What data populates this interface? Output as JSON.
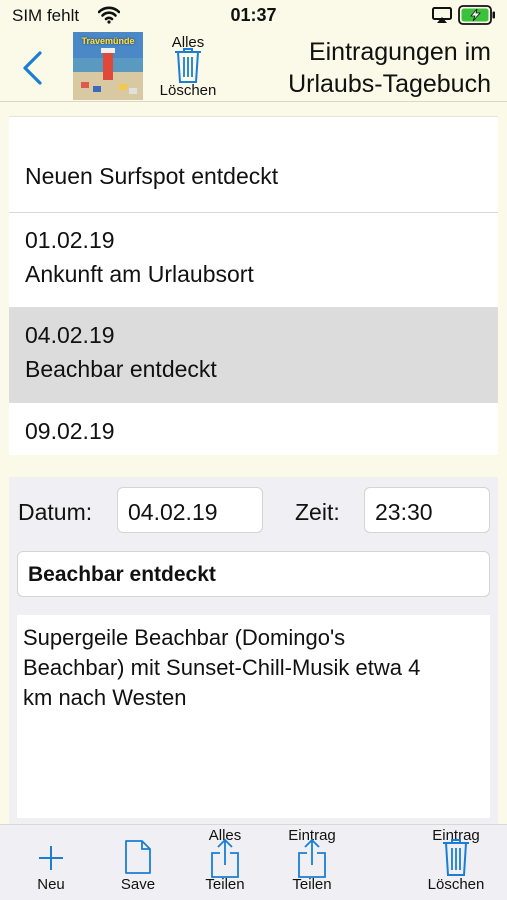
{
  "status_bar": {
    "carrier": "SIM fehlt",
    "time": "01:37"
  },
  "nav": {
    "thumbnail_text": "Travemünde",
    "delete_all_top": "Alles",
    "delete_all_bottom": "Löschen",
    "title_line1": "Eintragungen im",
    "title_line2": "Urlaubs-Tagebuch"
  },
  "list": {
    "top_row": "Neuen Surfspot entdeckt",
    "rows": [
      {
        "date": "01.02.19",
        "title": "Ankunft am Urlaubsort"
      },
      {
        "date": "04.02.19",
        "title": "Beachbar entdeckt"
      },
      {
        "date": "09.02.19",
        "title": ""
      }
    ]
  },
  "editor": {
    "date_label": "Datum:",
    "date_value": "04.02.19",
    "time_label": "Zeit:",
    "time_value": "23:30",
    "title_value": "Beachbar entdeckt",
    "body_line1": "Supergeile Beachbar (Domingo's",
    "body_line2": "Beachbar) mit Sunset-Chill-Musik etwa 4",
    "body_line3": "km nach Westen"
  },
  "toolbar": {
    "new_label": "Neu",
    "save_label": "Save",
    "share_all_top": "Alles",
    "share_all_bottom": "Teilen",
    "share_entry_top": "Eintrag",
    "share_entry_bottom": "Teilen",
    "delete_entry_top": "Eintrag",
    "delete_entry_bottom": "Löschen"
  },
  "colors": {
    "accent": "#1a7fd4",
    "background": "#fbf9e8",
    "selected_row": "#dcdcdc",
    "battery": "#3bc23b"
  }
}
